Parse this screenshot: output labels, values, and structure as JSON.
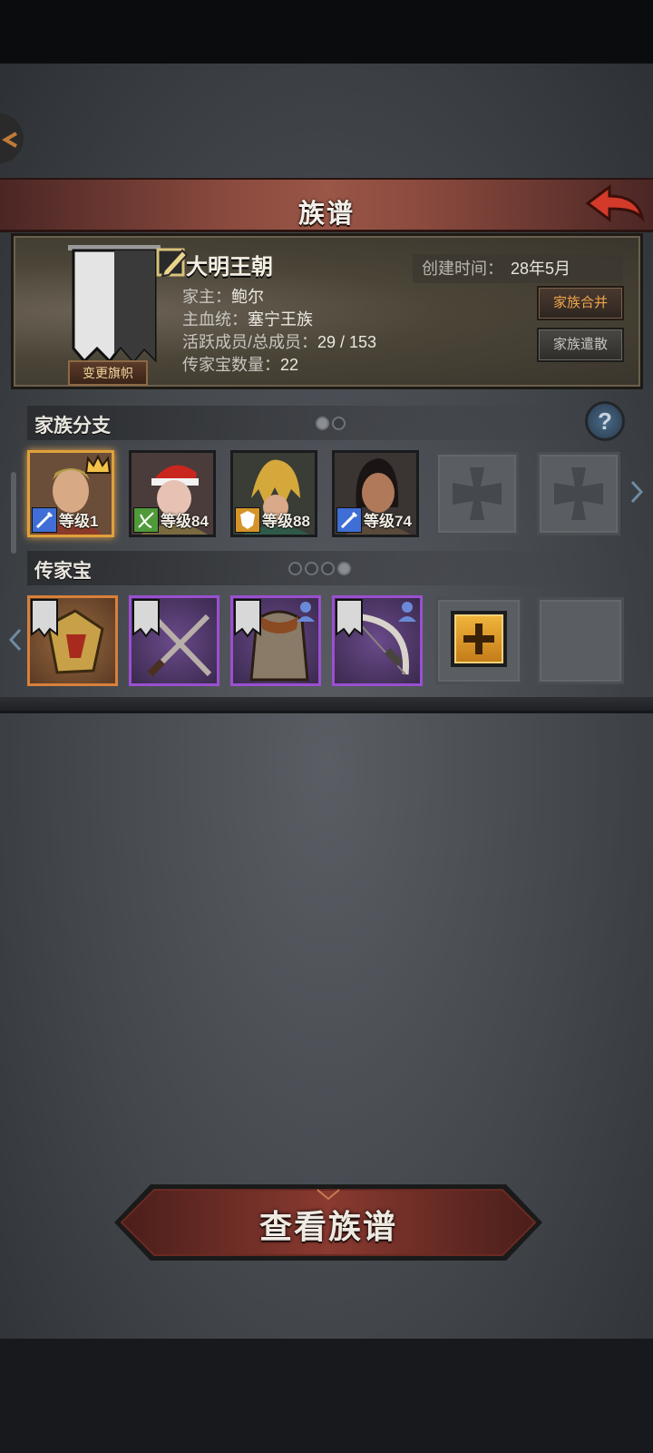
{
  "title": "族谱",
  "family": {
    "name": "大明王朝",
    "created_label": "创建时间：",
    "created_value": "28年5月",
    "head_label": "家主：",
    "head_value": "鲍尔",
    "bloodline_label": "主血统：",
    "bloodline_value": "塞宁王族",
    "members_label": "活跃成员/总成员：",
    "members_value": "29 / 153",
    "heirloom_label": "传家宝数量：",
    "heirloom_value": "22",
    "change_banner": "变更旗帜",
    "merge_button": "家族合并",
    "disband_button": "家族遣散"
  },
  "branches": {
    "title": "家族分支",
    "page_dots": 2,
    "active_dot": 0,
    "members": [
      {
        "level": "等级1",
        "skill_color": "#3f6fd6",
        "crown": true
      },
      {
        "level": "等级84",
        "skill_color": "#4f9a3a",
        "crown": false
      },
      {
        "level": "等级88",
        "skill_color": "#d4942a",
        "crown": false
      },
      {
        "level": "等级74",
        "skill_color": "#3f6fd6",
        "crown": false
      }
    ],
    "empty_slots": 2
  },
  "heirlooms": {
    "title": "传家宝",
    "page_dots": 4,
    "active_dot": 3,
    "items": [
      {
        "rarity": "orange",
        "icon": "ornate-armor-icon"
      },
      {
        "rarity": "purple",
        "icon": "crossed-swords-icon"
      },
      {
        "rarity": "purple",
        "icon": "fur-armor-icon"
      },
      {
        "rarity": "purple",
        "icon": "bow-icon"
      }
    ]
  },
  "main_button": "查看族谱",
  "colors": {
    "accent_orange": "#f0a54a",
    "title_red": "#8a4a3e",
    "purple_rarity": "#9b4fd1",
    "orange_rarity": "#d9803a"
  }
}
